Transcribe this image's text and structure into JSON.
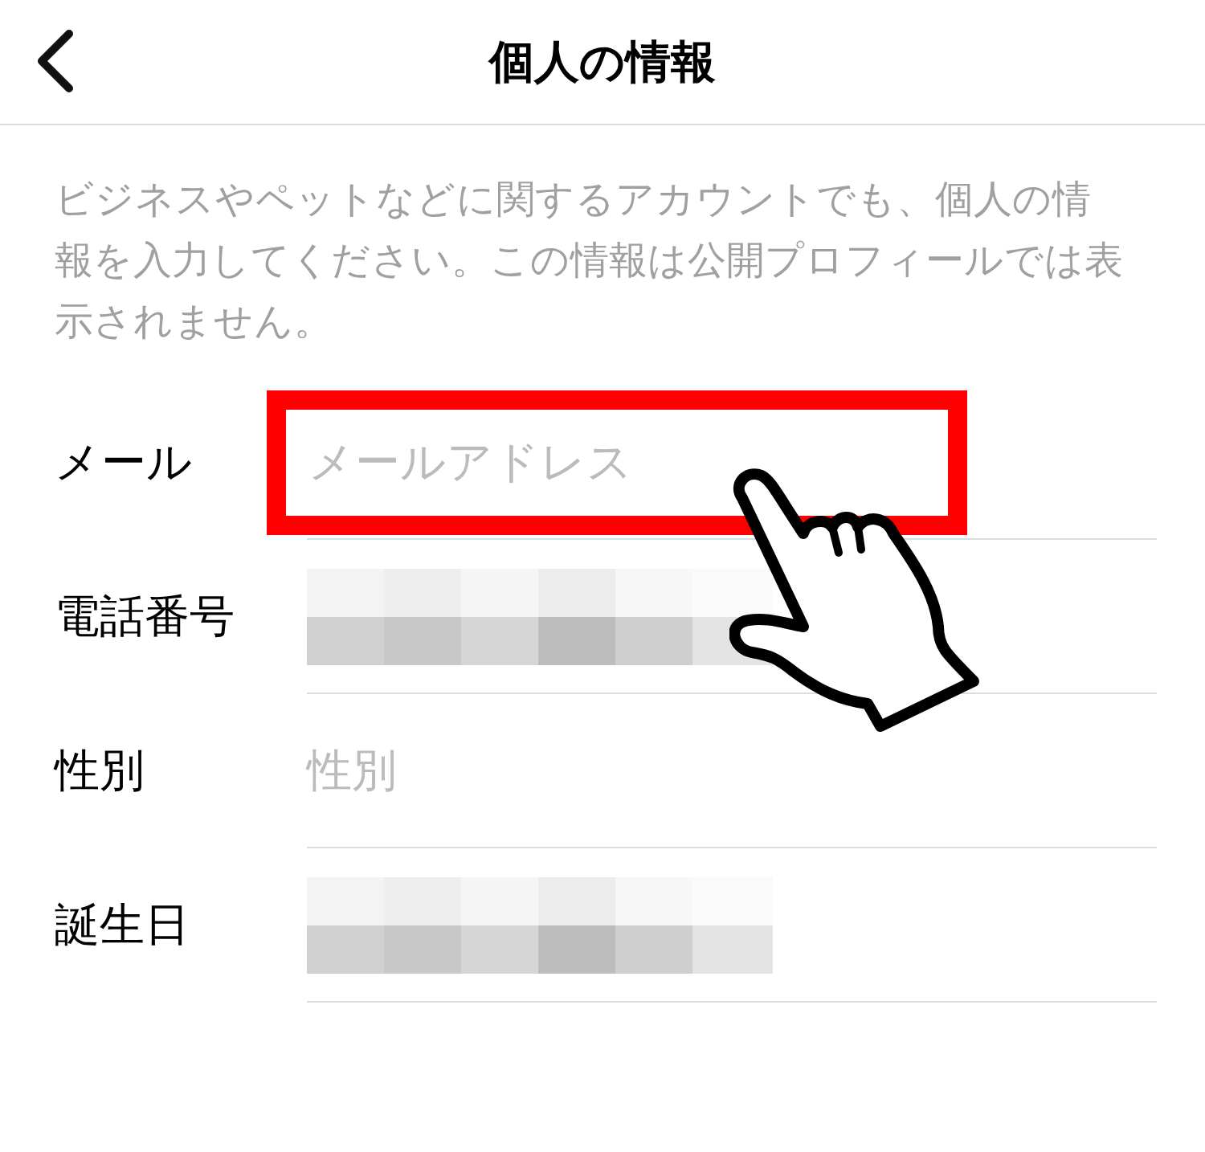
{
  "header": {
    "title": "個人の情報"
  },
  "description": "ビジネスやペットなどに関するアカウントでも、個人の情報を入力してください。この情報は公開プロフィールでは表示されません。",
  "fields": [
    {
      "label": "メール",
      "kind": "input",
      "placeholder": "メールアドレス",
      "highlighted": true
    },
    {
      "label": "電話番号",
      "kind": "redacted",
      "highlighted": false
    },
    {
      "label": "性別",
      "kind": "input",
      "placeholder": "性別",
      "highlighted": false
    },
    {
      "label": "誕生日",
      "kind": "redacted",
      "highlighted": false
    }
  ]
}
